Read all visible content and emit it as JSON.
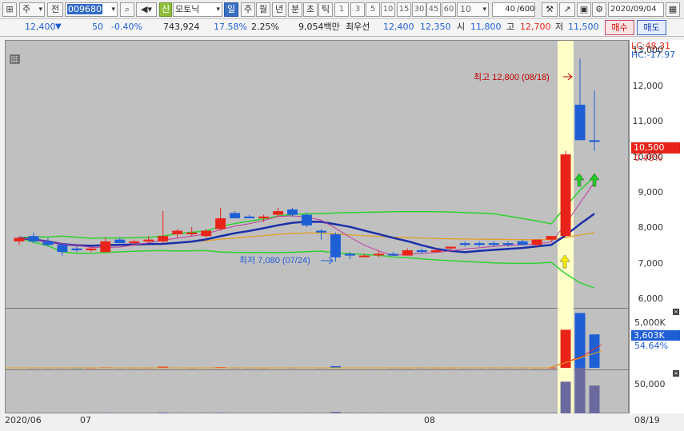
{
  "toolbar": {
    "ju_label": "주",
    "jeon_label": "전",
    "stock_code": "009680",
    "credit_label": "신",
    "stock_name": "모토닉",
    "periods": [
      "일",
      "주",
      "월",
      "년",
      "분",
      "초",
      "틱"
    ],
    "minute_steps": [
      "1",
      "3",
      "5",
      "10",
      "15",
      "30",
      "45",
      "60"
    ],
    "step_select": "10",
    "count_value": "40",
    "count_total": "/600",
    "date": "2020/09/04"
  },
  "info": {
    "price": "12,400",
    "direction": "▼",
    "change": "50",
    "change_pct": "-0.40%",
    "volume": "743,924",
    "turnover_pct": "17.58%",
    "ratio_pct": "2.25%",
    "amount": "9,054백만",
    "best_bid_label": "최우선",
    "best_ask": "12,400",
    "best_bid": "12,350",
    "open_label": "시",
    "open": "11,800",
    "high_label": "고",
    "high": "12,700",
    "low_label": "저",
    "low": "11,500",
    "buy_label": "매수",
    "sell_label": "매도"
  },
  "chart": {
    "lc_label": "LC:48.31",
    "hc_label": "HC:-17.97",
    "current_price_tag": "10,500",
    "current_pct_tag": "0.48%",
    "max_annotation": "최고 12,800 (08/18)",
    "min_annotation": "최저 7,080 (07/24)",
    "price_axis": [
      "13,000",
      "12,000",
      "11,000",
      "10,000",
      "9,000",
      "8,000",
      "7,000",
      "6,000"
    ],
    "volume_axis_label": "5,000K",
    "volume_tag": "3,603K",
    "volume_pct": "54.64%",
    "amount_axis_label": "50,000",
    "x_labels": [
      "2020/06",
      "07",
      "08",
      "08/19"
    ],
    "colors": {
      "up": "#e8241a",
      "down": "#1f5fd6",
      "ma_blue": "#1a2fa8",
      "bollinger": "#2fd12f",
      "highlight": "#ffffc8"
    }
  },
  "chart_data": {
    "type": "candlestick",
    "candles": [
      {
        "o": 7650,
        "h": 7800,
        "l": 7550,
        "c": 7750
      },
      {
        "o": 7800,
        "h": 7900,
        "l": 7600,
        "c": 7650
      },
      {
        "o": 7650,
        "h": 7750,
        "l": 7500,
        "c": 7550
      },
      {
        "o": 7550,
        "h": 7600,
        "l": 7250,
        "c": 7350
      },
      {
        "o": 7450,
        "h": 7500,
        "l": 7350,
        "c": 7400
      },
      {
        "o": 7400,
        "h": 7500,
        "l": 7350,
        "c": 7450
      },
      {
        "o": 7350,
        "h": 7750,
        "l": 7350,
        "c": 7650
      },
      {
        "o": 7700,
        "h": 7750,
        "l": 7600,
        "c": 7600
      },
      {
        "o": 7600,
        "h": 7700,
        "l": 7550,
        "c": 7650
      },
      {
        "o": 7650,
        "h": 7800,
        "l": 7600,
        "c": 7700
      },
      {
        "o": 7650,
        "h": 8500,
        "l": 7600,
        "c": 7800
      },
      {
        "o": 7850,
        "h": 8000,
        "l": 7750,
        "c": 7950
      },
      {
        "o": 7850,
        "h": 8050,
        "l": 7800,
        "c": 7900
      },
      {
        "o": 7800,
        "h": 8000,
        "l": 7750,
        "c": 7950
      },
      {
        "o": 8000,
        "h": 8600,
        "l": 7950,
        "c": 8300
      },
      {
        "o": 8450,
        "h": 8500,
        "l": 8300,
        "c": 8300
      },
      {
        "o": 8350,
        "h": 8400,
        "l": 8300,
        "c": 8300
      },
      {
        "o": 8300,
        "h": 8400,
        "l": 8200,
        "c": 8350
      },
      {
        "o": 8400,
        "h": 8600,
        "l": 8350,
        "c": 8500
      },
      {
        "o": 8550,
        "h": 8600,
        "l": 8350,
        "c": 8400
      },
      {
        "o": 8400,
        "h": 8450,
        "l": 8050,
        "c": 8100
      },
      {
        "o": 7950,
        "h": 8000,
        "l": 7700,
        "c": 7900
      },
      {
        "o": 7850,
        "h": 7900,
        "l": 7080,
        "c": 7200
      },
      {
        "o": 7300,
        "h": 7350,
        "l": 7150,
        "c": 7250
      },
      {
        "o": 7250,
        "h": 7300,
        "l": 7200,
        "c": 7250
      },
      {
        "o": 7300,
        "h": 7400,
        "l": 7200,
        "c": 7300
      },
      {
        "o": 7300,
        "h": 7350,
        "l": 7250,
        "c": 7250
      },
      {
        "o": 7250,
        "h": 7450,
        "l": 7250,
        "c": 7400
      },
      {
        "o": 7400,
        "h": 7450,
        "l": 7300,
        "c": 7350
      },
      {
        "o": 7350,
        "h": 7450,
        "l": 7350,
        "c": 7400
      },
      {
        "o": 7450,
        "h": 7500,
        "l": 7400,
        "c": 7500
      },
      {
        "o": 7600,
        "h": 7650,
        "l": 7500,
        "c": 7550
      },
      {
        "o": 7600,
        "h": 7650,
        "l": 7500,
        "c": 7550
      },
      {
        "o": 7600,
        "h": 7650,
        "l": 7500,
        "c": 7550
      },
      {
        "o": 7600,
        "h": 7650,
        "l": 7500,
        "c": 7550
      },
      {
        "o": 7650,
        "h": 7700,
        "l": 7550,
        "c": 7550
      },
      {
        "o": 7550,
        "h": 7700,
        "l": 7500,
        "c": 7700
      },
      {
        "o": 7700,
        "h": 7800,
        "l": 7650,
        "c": 7800
      },
      {
        "o": 7800,
        "h": 10200,
        "l": 7800,
        "c": 10100
      },
      {
        "o": 11500,
        "h": 12800,
        "l": 10500,
        "c": 10500
      },
      {
        "o": 10500,
        "h": 11900,
        "l": 10200,
        "c": 10450
      }
    ],
    "volume": [
      40,
      30,
      30,
      30,
      20,
      20,
      60,
      30,
      30,
      30,
      120,
      40,
      30,
      40,
      80,
      30,
      30,
      30,
      40,
      30,
      40,
      30,
      180,
      40,
      40,
      40,
      30,
      30,
      30,
      30,
      30,
      30,
      30,
      30,
      30,
      30,
      30,
      30,
      4100,
      5900,
      3603
    ],
    "y_range": [
      5800,
      13300
    ]
  }
}
